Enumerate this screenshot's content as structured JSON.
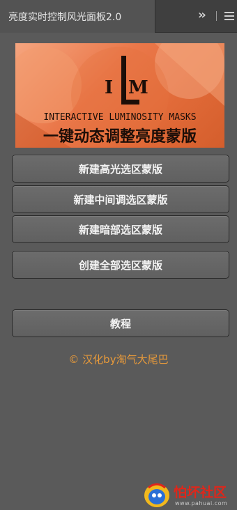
{
  "panel": {
    "tab_title": "亮度实时控制风光面板2.0",
    "collapse_icon": "double-chevron-right-icon",
    "menu_icon": "hamburger-menu-icon"
  },
  "banner": {
    "logo_text": "ILM",
    "subtitle": "INTERACTIVE LUMINOSITY MASKS",
    "title": "一键动态调整亮度蒙版"
  },
  "buttons": [
    "新建高光选区蒙版",
    "新建中间调选区蒙版",
    "新建暗部选区蒙版",
    "创建全部选区蒙版"
  ],
  "tutorial_button": "教程",
  "credit": "© 汉化by淘气大尾巴",
  "watermark": {
    "name": "怕坏社区",
    "url": "www.pahuai.com"
  },
  "colors": {
    "panel_bg": "#5a5a5a",
    "button_bg": "#666666",
    "credit": "#e89a3a",
    "banner_orange": "#e16a38"
  }
}
